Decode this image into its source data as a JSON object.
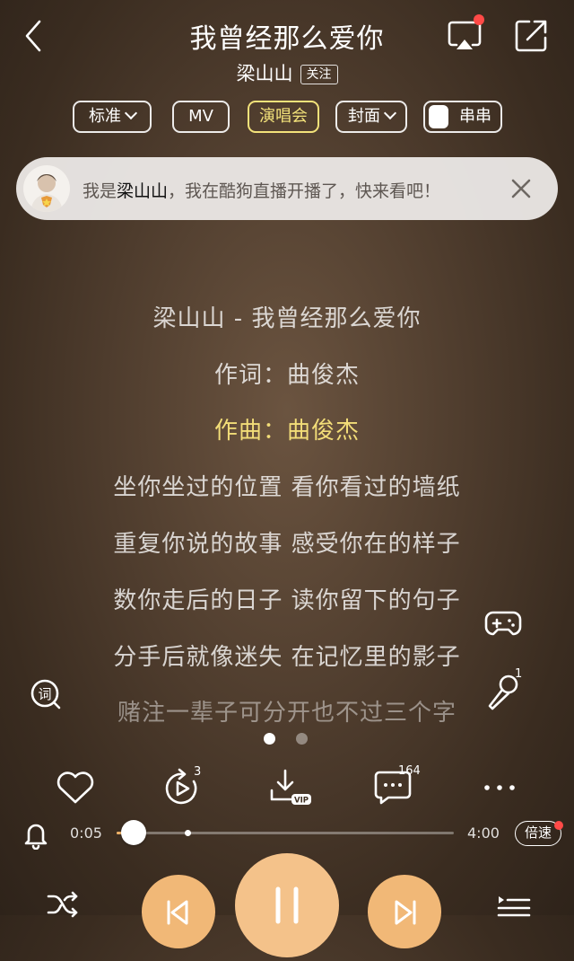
{
  "header": {
    "title": "我曾经那么爱你",
    "artist": "梁山山",
    "follow_label": "关注"
  },
  "options": [
    {
      "label": "标准",
      "dropdown": true,
      "active": false
    },
    {
      "label": "MV",
      "dropdown": false,
      "active": false
    },
    {
      "label": "演唱会",
      "dropdown": false,
      "active": true
    },
    {
      "label": "封面",
      "dropdown": true,
      "active": false
    },
    {
      "label": "串串",
      "dropdown": false,
      "active": false
    }
  ],
  "banner": {
    "prefix": "我是",
    "name": "梁山山",
    "suffix": "，我在酷狗直播开播了，快来看吧！"
  },
  "lyrics": [
    {
      "text": "梁山山 - 我曾经那么爱你",
      "state": "normal"
    },
    {
      "text": "作词：曲俊杰",
      "state": "normal"
    },
    {
      "text": "作曲：曲俊杰",
      "state": "current"
    },
    {
      "text": "坐你坐过的位置 看你看过的墙纸",
      "state": "normal"
    },
    {
      "text": "重复你说的故事 感受你在的样子",
      "state": "normal"
    },
    {
      "text": "数你走后的日子 读你留下的句子",
      "state": "normal"
    },
    {
      "text": "分手后就像迷失 在记忆里的影子",
      "state": "normal"
    },
    {
      "text": "赌注一辈子可分开也不过三个字",
      "state": "fade"
    }
  ],
  "pager": {
    "total": 2,
    "active": 0
  },
  "side": {
    "mic_count": "1"
  },
  "actions": {
    "repeat_count": "3",
    "download_badge": "VIP",
    "comment_count": "164"
  },
  "player": {
    "current_time": "0:05",
    "total_time": "4:00",
    "progress": 0.05,
    "speed_label": "倍速"
  },
  "colors": {
    "accent": "#f2dd78",
    "control": "#f1b877",
    "badge": "#ff4a47"
  }
}
